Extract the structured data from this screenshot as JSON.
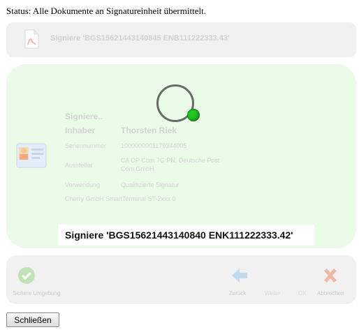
{
  "status": "Status: Alle Dokumente an Signatureinheit übermittelt.",
  "document": {
    "title": "Signiere 'BGS15621443140845 ENB111222333.43'",
    "icon": "pdf-document-icon"
  },
  "card": {
    "icon": "signature-card-icon",
    "heading": "Signiere..",
    "rows": [
      {
        "label": "Inhaber",
        "value": "Thorsten Riek"
      },
      {
        "label": "Seriennummer",
        "value": "1000000001179344005"
      },
      {
        "label": "Aussteller",
        "value": "CA DP Com 7G:PN, Deutsche Post Com GmbH"
      },
      {
        "label": "Verwendung",
        "value": "Qualifizierte Signatur"
      }
    ],
    "reader": "Cherry GmbH SmartTerminal ST-2xxx 0"
  },
  "signing_message": "Signiere 'BGS15621443140840 ENK111222333.42'",
  "actions": {
    "secure_environment": "Sichere Umgebung",
    "back": "Zurück",
    "next": "Weiter",
    "ok": "OK",
    "cancel": "Abbrechen"
  },
  "close_button": "Schließen",
  "colors": {
    "panel_green": "#eafbe7",
    "spinner_dot": "#22c422",
    "panel_gray": "#f1f1f1"
  }
}
